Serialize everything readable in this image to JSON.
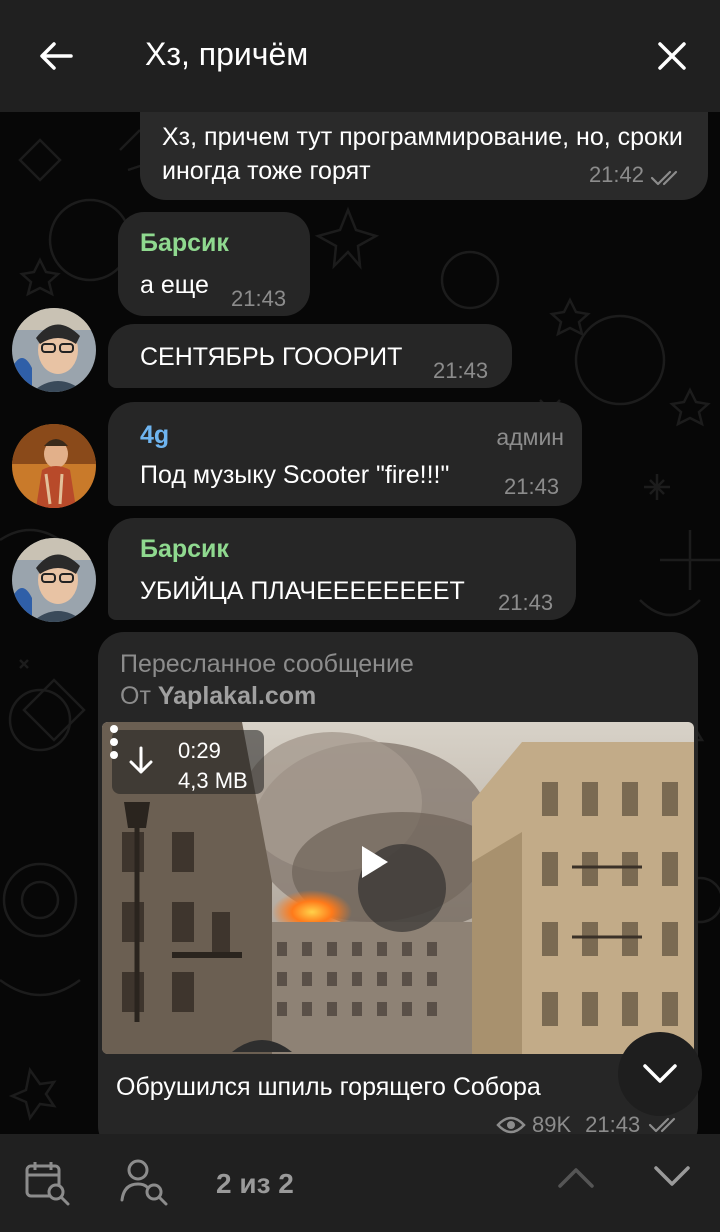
{
  "header": {
    "title": "Хз, причём"
  },
  "messages": [
    {
      "text": "Хз, причем тут программирование, но, сроки иногда тоже горят",
      "time": "21:42"
    },
    {
      "sender": "Барсик",
      "text": "а еще",
      "time": "21:43"
    },
    {
      "text": "СЕНТЯБРЬ ГОООРИТ",
      "time": "21:43"
    },
    {
      "sender": "4g",
      "role": "админ",
      "text": "Под музыку Scooter \"fire!!!\"",
      "time": "21:43"
    },
    {
      "sender": "Барсик",
      "text": "УБИЙЦА ПЛАЧЕЕЕЕЕЕЕЕТ",
      "time": "21:43"
    }
  ],
  "forwarded": {
    "label": "Пересланное сообщение",
    "from_prefix": "От ",
    "from_name": "Yaplakal.com",
    "video_duration": "0:29",
    "video_size": "4,3 MB",
    "caption": "Обрушился шпиль горящего Собора",
    "views": "89K",
    "time": "21:43"
  },
  "bottombar": {
    "count": "2 из 2"
  },
  "colors": {
    "header_bg": "#202020",
    "bubble_bg": "#262626",
    "sender_green": "#8fd98f",
    "sender_blue": "#6fb5f0",
    "meta_gray": "#8c8c8c"
  },
  "icons": {
    "back": "arrow-left-icon",
    "close": "close-icon",
    "download": "download-arrow-icon",
    "menu": "more-vertical-icon",
    "play": "play-icon",
    "eye": "eye-icon",
    "read": "double-check-icon",
    "scroll": "chevron-down-icon",
    "calendar": "calendar-search-icon",
    "user": "user-search-icon",
    "up": "chevron-up-icon",
    "down": "chevron-down-icon"
  }
}
